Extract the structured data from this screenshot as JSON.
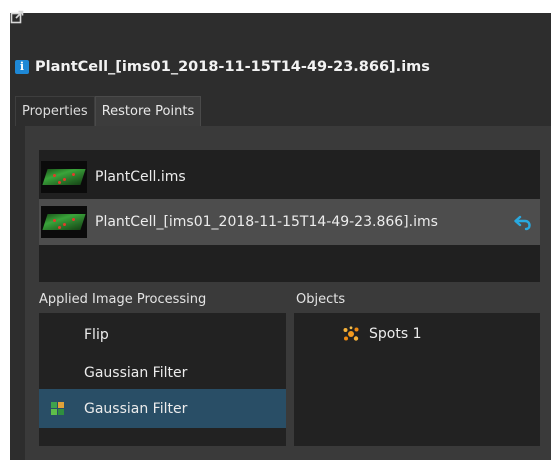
{
  "header": {
    "title": "PlantCell_[ims01_2018-11-15T14-49-23.866].ims"
  },
  "tabs": [
    {
      "label": "Properties",
      "active": false
    },
    {
      "label": "Restore Points",
      "active": true
    }
  ],
  "restore_points": [
    {
      "label": "PlantCell.ims",
      "selected": false
    },
    {
      "label": "PlantCell_[ims01_2018-11-15T14-49-23.866].ims",
      "selected": true
    }
  ],
  "processing": {
    "label": "Applied Image Processing",
    "items": [
      {
        "label": "Flip",
        "selected": false
      },
      {
        "label": "Gaussian Filter",
        "selected": false
      },
      {
        "label": "Gaussian Filter",
        "selected": true
      }
    ]
  },
  "objects": {
    "label": "Objects",
    "items": [
      {
        "label": "Spots 1",
        "icon": "spots-icon"
      }
    ]
  },
  "colors": {
    "background": "#2d2d2d",
    "selection": "#294e66",
    "accent": "#29a9e0"
  }
}
